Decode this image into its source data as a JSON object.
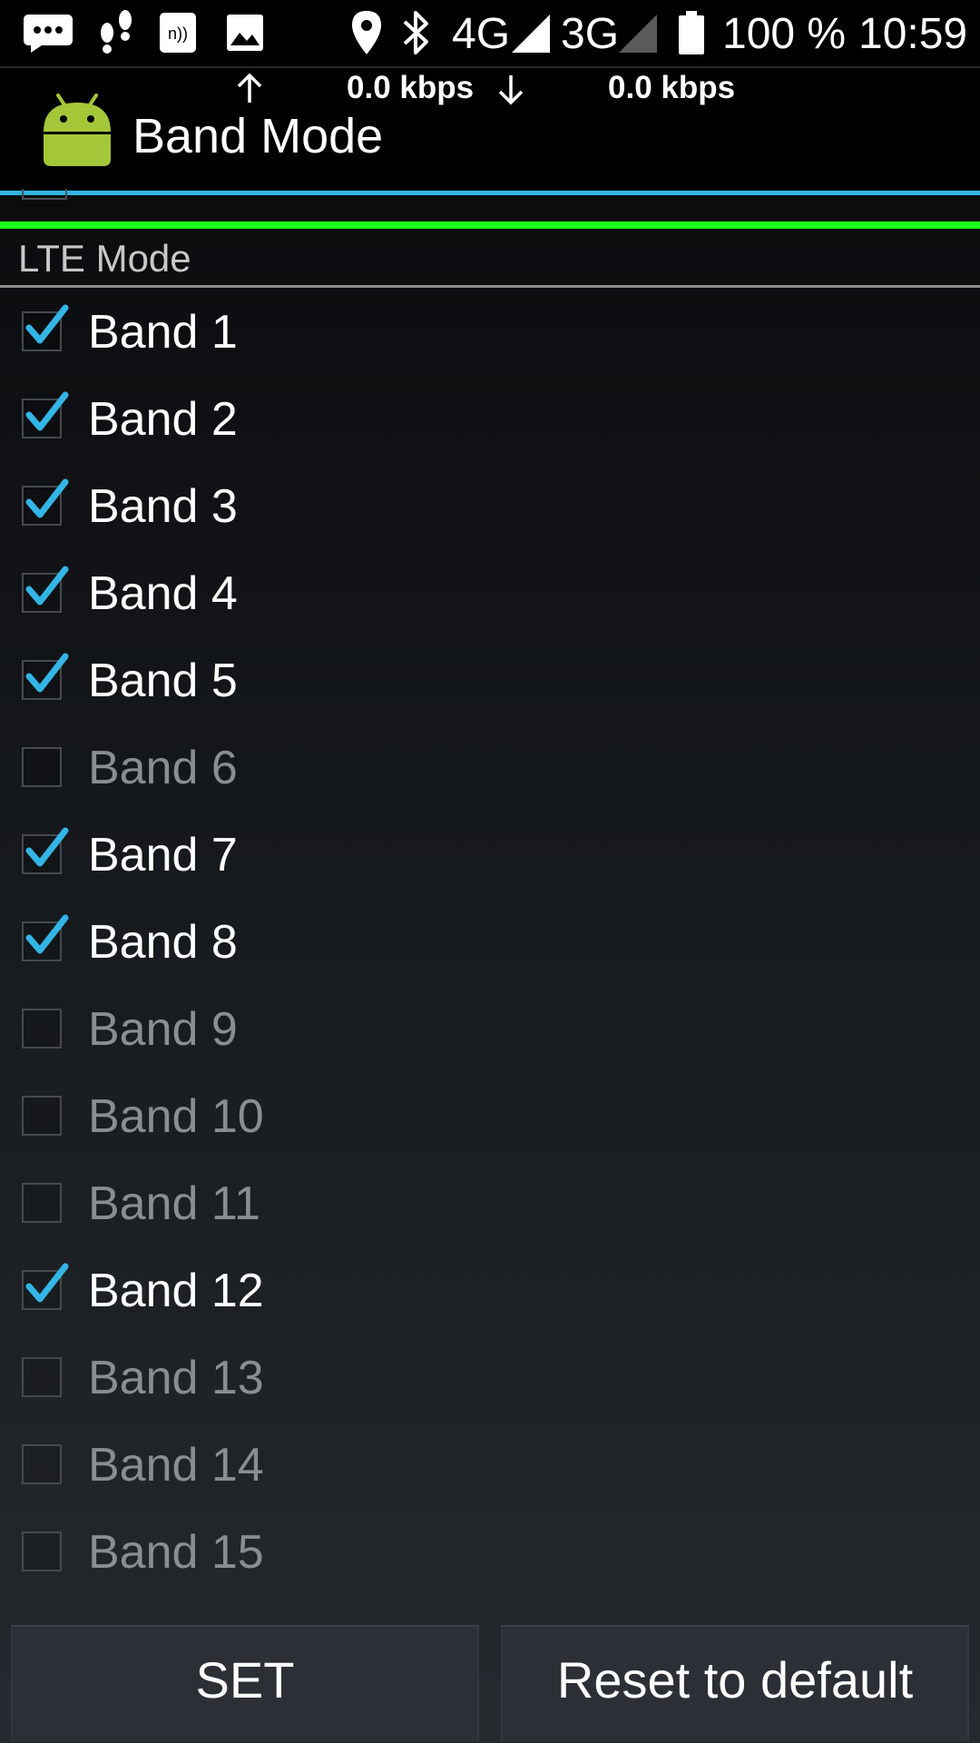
{
  "status_bar": {
    "network_4g": "4G",
    "network_3g": "3G",
    "battery": "100 %",
    "time": "10:59",
    "icons": [
      "chat-icon",
      "footsteps-icon",
      "nfc-icon",
      "image-icon",
      "location-icon",
      "bluetooth-icon",
      "signal-4g-icon",
      "signal-3g-icon",
      "battery-icon"
    ]
  },
  "action_bar": {
    "upload_speed": "0.0 kbps",
    "download_speed": "0.0 kbps",
    "title": "Band Mode",
    "app_icon": "android-icon"
  },
  "colors": {
    "accent": "#33b5e5",
    "green_line": "#19ff19",
    "checked_text": "#ffffff",
    "unchecked_text": "#8a8d91"
  },
  "section": {
    "header": "LTE Mode"
  },
  "bands": [
    {
      "label": "Band 1",
      "checked": true
    },
    {
      "label": "Band 2",
      "checked": true
    },
    {
      "label": "Band 3",
      "checked": true
    },
    {
      "label": "Band 4",
      "checked": true
    },
    {
      "label": "Band 5",
      "checked": true
    },
    {
      "label": "Band 6",
      "checked": false
    },
    {
      "label": "Band 7",
      "checked": true
    },
    {
      "label": "Band 8",
      "checked": true
    },
    {
      "label": "Band 9",
      "checked": false
    },
    {
      "label": "Band 10",
      "checked": false
    },
    {
      "label": "Band 11",
      "checked": false
    },
    {
      "label": "Band 12",
      "checked": true
    },
    {
      "label": "Band 13",
      "checked": false
    },
    {
      "label": "Band 14",
      "checked": false
    },
    {
      "label": "Band 15",
      "checked": false
    }
  ],
  "buttons": {
    "set": "SET",
    "reset": "Reset to default"
  }
}
